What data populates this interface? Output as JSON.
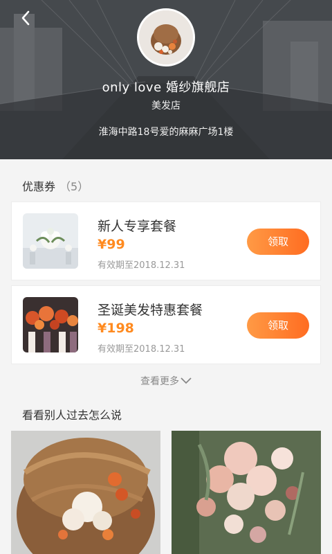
{
  "header": {
    "back_icon": "chevron-left-icon",
    "store_name": "only love 婚纱旗舰店",
    "store_type": "美发店",
    "address": "淮海中路18号爱的麻麻广场1楼"
  },
  "coupons": {
    "title": "优惠券",
    "count": "（5）",
    "items": [
      {
        "title": "新人专享套餐",
        "price": "¥99",
        "valid": "有效期至2018.12.31",
        "button": "领取"
      },
      {
        "title": "圣诞美发特惠套餐",
        "price": "¥198",
        "valid": "有效期至2018.12.31",
        "button": "领取"
      }
    ],
    "more_label": "查看更多"
  },
  "reviews": {
    "title": "看看别人过去怎么说"
  },
  "colors": {
    "accent": "#ff8a1f",
    "button_gradient_start": "#ff9a45",
    "button_gradient_end": "#ff6c21"
  }
}
